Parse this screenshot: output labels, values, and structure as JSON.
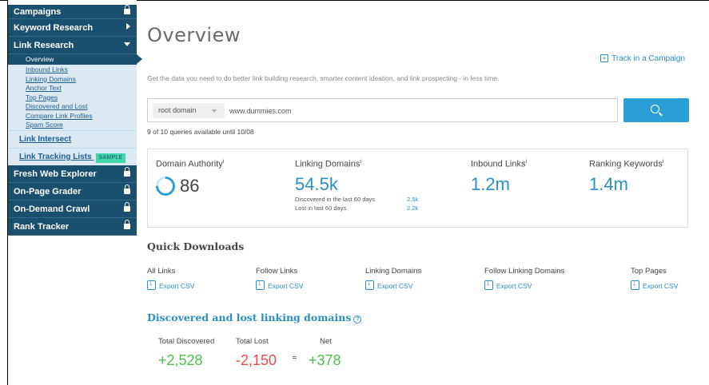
{
  "sidebar": {
    "campaigns": "Campaigns",
    "keyword_research": "Keyword Research",
    "link_research": "Link Research",
    "sub_items": [
      "Overview",
      "Inbound Links",
      "Linking Domains",
      "Anchor Text",
      "Top Pages",
      "Discovered and Lost",
      "Compare Link Profiles",
      "Spam Score"
    ],
    "link_intersect": "Link Intersect",
    "link_tracking": "Link Tracking Lists",
    "sample_badge": "SAMPLE",
    "fresh_web_explorer": "Fresh Web Explorer",
    "on_page_grader": "On-Page Grader",
    "on_demand_crawl": "On-Demand Crawl",
    "rank_tracker": "Rank Tracker"
  },
  "main": {
    "title": "Overview",
    "track_link": "Track in a Campaign",
    "description": "Get the data you need to do better link building research, smarter content ideation, and link prospecting - in less time.",
    "search": {
      "scope": "root domain",
      "value": "www.dummies.com"
    },
    "queries": "9 of 10 queries available until 10/08"
  },
  "metrics": {
    "domain_authority": {
      "label": "Domain Authority",
      "value": "86"
    },
    "linking_domains": {
      "label": "Linking Domains",
      "value": "54.5k",
      "discovered_label": "Discovered in the last 60 days",
      "discovered_value": "2.5k",
      "lost_label": "Lost in last 60 days",
      "lost_value": "2.2k"
    },
    "inbound_links": {
      "label": "Inbound Links",
      "value": "1.2m"
    },
    "ranking_keywords": {
      "label": "Ranking Keywords",
      "value": "1.4m"
    },
    "info_marker": "i"
  },
  "quick_downloads": {
    "title": "Quick Downloads",
    "export_label": "Export CSV",
    "items": [
      "All Links",
      "Follow Links",
      "Linking Domains",
      "Follow Linking Domains",
      "Top Pages"
    ]
  },
  "discovered_lost": {
    "title": "Discovered and lost linking domains",
    "total_discovered_label": "Total Discovered",
    "total_discovered": "+2,528",
    "total_lost_label": "Total Lost",
    "total_lost": "-2,150",
    "net_label": "Net",
    "net": "+378"
  },
  "colors": {
    "sidebar_dark": "#1b4f6e",
    "accent": "#2a8fc2",
    "positive": "#4cbf4c",
    "negative": "#f04b4b"
  },
  "icons": [
    "lock-icon",
    "chevron-right-icon",
    "chevron-down-icon",
    "plus-box-icon",
    "search-icon",
    "download-icon",
    "help-circle-icon",
    "progress-ring-icon"
  ]
}
